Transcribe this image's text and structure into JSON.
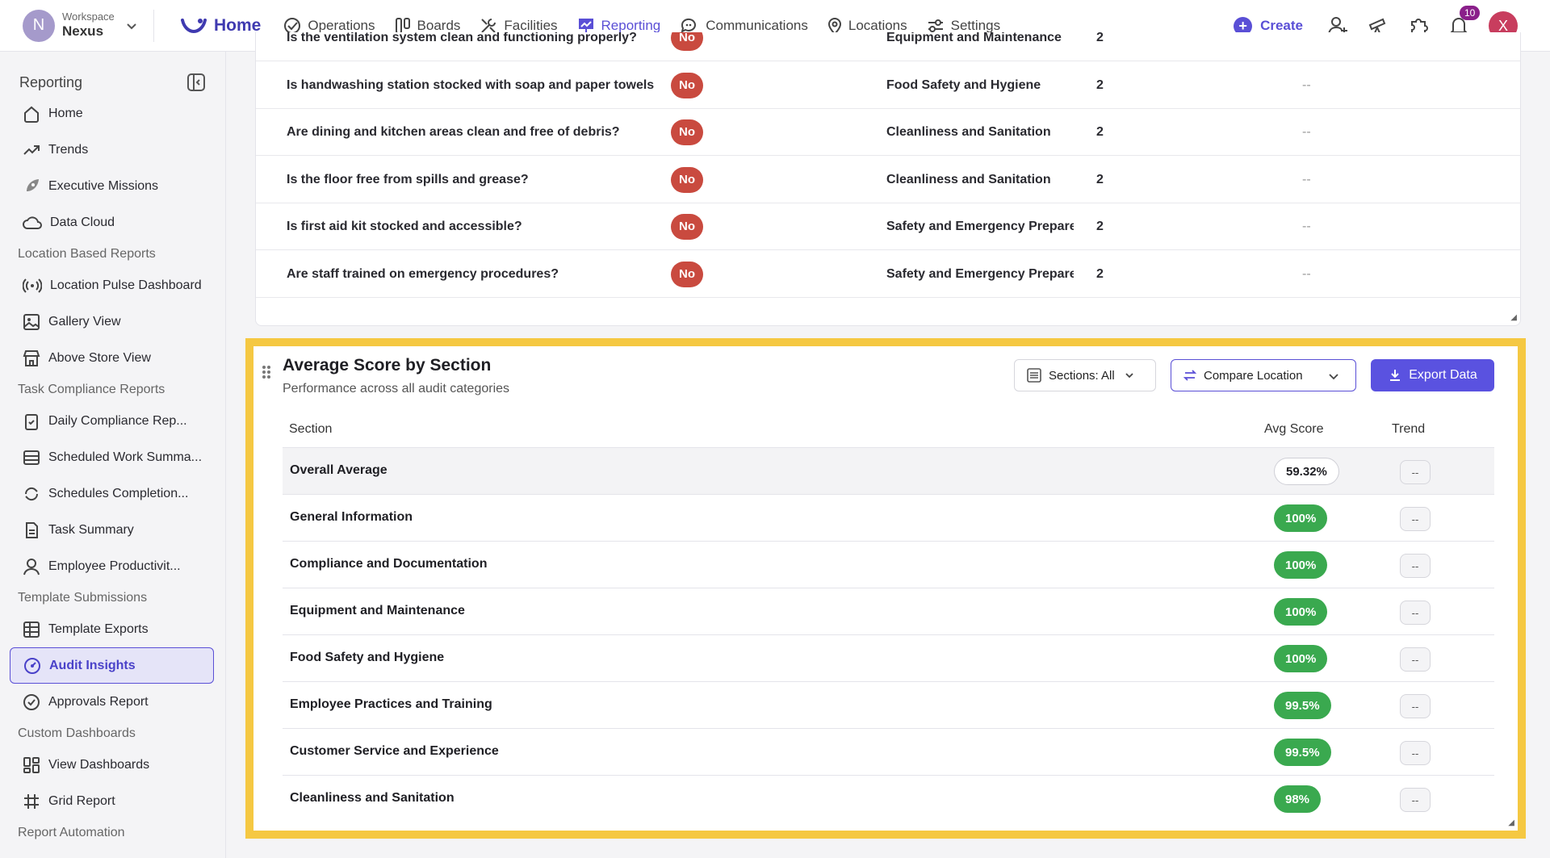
{
  "workspace": {
    "initial": "N",
    "label": "Workspace",
    "name": "Nexus"
  },
  "nav": {
    "home": "Home",
    "items": [
      "Operations",
      "Boards",
      "Facilities",
      "Reporting",
      "Communications",
      "Locations",
      "Settings"
    ],
    "active": "Reporting"
  },
  "topbar": {
    "create": "Create",
    "notifications_count": "10",
    "user_initial": "X"
  },
  "sidebar": {
    "title": "Reporting",
    "home": "Home",
    "trends": "Trends",
    "executive_missions": "Executive Missions",
    "data_cloud": "Data Cloud",
    "sec_location": "Location Based Reports",
    "location_pulse": "Location Pulse Dashboard",
    "gallery_view": "Gallery View",
    "above_store": "Above Store View",
    "sec_task": "Task Compliance Reports",
    "daily_compliance": "Daily Compliance Rep...",
    "scheduled_work": "Scheduled Work Summa...",
    "schedules_completion": "Schedules Completion...",
    "task_summary": "Task Summary",
    "employee_productivity": "Employee Productivit...",
    "sec_template": "Template Submissions",
    "template_exports": "Template Exports",
    "audit_insights": "Audit Insights",
    "approvals_report": "Approvals Report",
    "sec_custom": "Custom Dashboards",
    "view_dashboards": "View Dashboards",
    "grid_report": "Grid Report",
    "sec_automation": "Report Automation"
  },
  "upper_table": {
    "rows": [
      {
        "question": "Is the ventilation system clean and functioning properly?",
        "answer": "No",
        "section": "Equipment and Maintenance",
        "count": "2",
        "trend": ""
      },
      {
        "question": "Is handwashing station stocked with soap and paper towels?",
        "answer": "No",
        "section": "Food Safety and Hygiene",
        "count": "2",
        "trend": "--"
      },
      {
        "question": "Are dining and kitchen areas clean and free of debris?",
        "answer": "No",
        "section": "Cleanliness and Sanitation",
        "count": "2",
        "trend": "--"
      },
      {
        "question": "Is the floor free from spills and grease?",
        "answer": "No",
        "section": "Cleanliness and Sanitation",
        "count": "2",
        "trend": "--"
      },
      {
        "question": "Is first aid kit stocked and accessible?",
        "answer": "No",
        "section": "Safety and Emergency Prepare",
        "count": "2",
        "trend": "--"
      },
      {
        "question": "Are staff trained on emergency procedures?",
        "answer": "No",
        "section": "Safety and Emergency Prepare",
        "count": "2",
        "trend": "--"
      }
    ]
  },
  "score_card": {
    "title": "Average Score by Section",
    "subtitle": "Performance across all audit categories",
    "sections_filter": "Sections: All",
    "compare": "Compare Location",
    "export": "Export Data",
    "col_section": "Section",
    "col_avg": "Avg Score",
    "col_trend": "Trend",
    "rows": [
      {
        "name": "Overall Average",
        "score": "59.32%",
        "trend": "--"
      },
      {
        "name": "General Information",
        "score": "100%",
        "trend": "--"
      },
      {
        "name": "Compliance and Documentation",
        "score": "100%",
        "trend": "--"
      },
      {
        "name": "Equipment and Maintenance",
        "score": "100%",
        "trend": "--"
      },
      {
        "name": "Food Safety and Hygiene",
        "score": "100%",
        "trend": "--"
      },
      {
        "name": "Employee Practices and Training",
        "score": "99.5%",
        "trend": "--"
      },
      {
        "name": "Customer Service and Experience",
        "score": "99.5%",
        "trend": "--"
      },
      {
        "name": "Cleanliness and Sanitation",
        "score": "98%",
        "trend": "--"
      }
    ]
  },
  "colors": {
    "accent": "#5a4fd6",
    "highlight": "#f5c842",
    "score_green": "#3aa94f",
    "no_red": "#c94a3f"
  }
}
